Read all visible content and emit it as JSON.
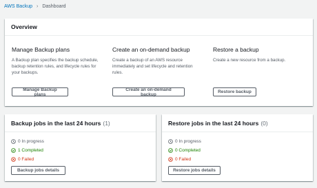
{
  "breadcrumb": {
    "root": "AWS Backup",
    "current": "Dashboard"
  },
  "overview": {
    "title": "Overview",
    "columns": [
      {
        "heading": "Manage Backup plans",
        "description": "A Backup plan specifies the backup schedule, backup retention rules, and lifecycle rules for your backups.",
        "button": "Manage Backup plans"
      },
      {
        "heading": "Create an on-demand backup",
        "description": "Create a backup of an AWS resource immediately and set lifecycle and retention rules.",
        "button": "Create an on-demand backup"
      },
      {
        "heading": "Restore a backup",
        "description": "Create a new resource from a backup.",
        "button": "Restore backup"
      }
    ]
  },
  "backup_jobs": {
    "title": "Backup jobs in the last 24 hours",
    "count": "(1)",
    "in_progress": "0 In progress",
    "completed": "1 Completed",
    "failed": "0 Failed",
    "button": "Backup jobs details"
  },
  "restore_jobs": {
    "title": "Restore jobs in the last 24 hours",
    "count": "(0)",
    "in_progress": "0 In progress",
    "completed": "0 Completed",
    "failed": "0 Failed",
    "button": "Restore jobs details"
  },
  "colors": {
    "link": "#0073bb",
    "success": "#1d8102",
    "error": "#d13212",
    "neutral": "#545b64"
  },
  "icons": {
    "in_progress": "clock-icon",
    "completed": "check-circle-icon",
    "failed": "x-circle-icon"
  }
}
